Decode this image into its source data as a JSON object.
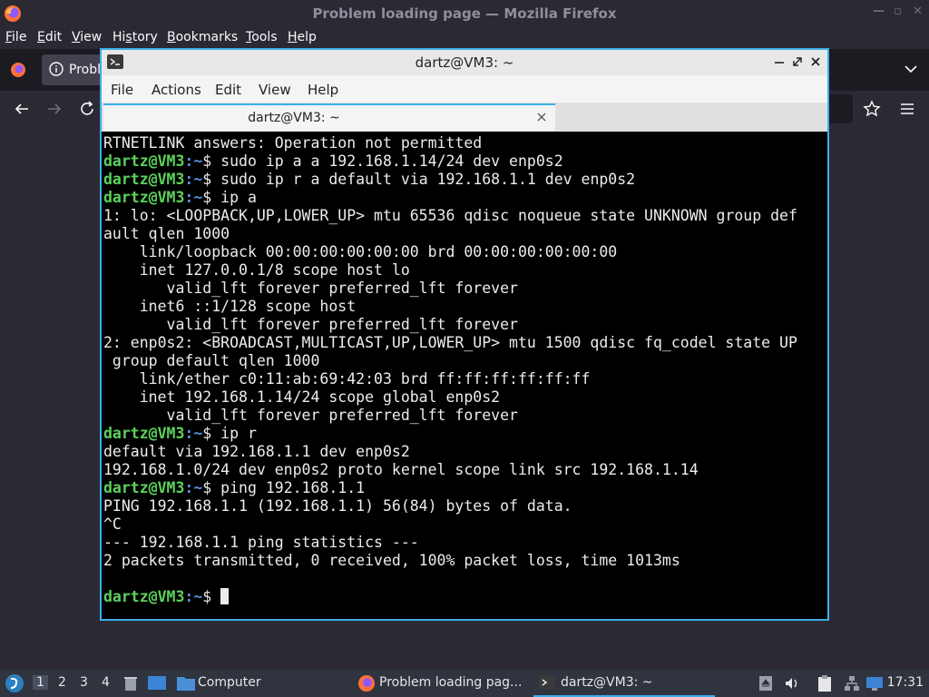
{
  "firefox": {
    "window_title": "Problem loading page — Mozilla Firefox",
    "menu": [
      "File",
      "Edit",
      "View",
      "History",
      "Bookmarks",
      "Tools",
      "Help"
    ],
    "menu_underline": [
      "F",
      "E",
      "V",
      "H",
      "B",
      "T",
      "H"
    ],
    "tab_title": "Probl"
  },
  "terminal": {
    "window_title": "dartz@VM3: ~",
    "menu": [
      "File",
      "Actions",
      "Edit",
      "View",
      "Help"
    ],
    "tab_title": "dartz@VM3: ~",
    "prompt_user": "dartz@VM3",
    "prompt_path": ":~",
    "prompt_symbol": "$ ",
    "lines": [
      {
        "text": "RTNETLINK answers: Operation not permitted"
      },
      {
        "prompt": true,
        "text": "sudo ip a a 192.168.1.14/24 dev enp0s2"
      },
      {
        "prompt": true,
        "text": "sudo ip r a default via 192.168.1.1 dev enp0s2"
      },
      {
        "prompt": true,
        "text": "ip a"
      },
      {
        "text": "1: lo: <LOOPBACK,UP,LOWER_UP> mtu 65536 qdisc noqueue state UNKNOWN group def"
      },
      {
        "text": "ault qlen 1000"
      },
      {
        "text": "    link/loopback 00:00:00:00:00:00 brd 00:00:00:00:00:00"
      },
      {
        "text": "    inet 127.0.0.1/8 scope host lo"
      },
      {
        "text": "       valid_lft forever preferred_lft forever"
      },
      {
        "text": "    inet6 ::1/128 scope host"
      },
      {
        "text": "       valid_lft forever preferred_lft forever"
      },
      {
        "text": "2: enp0s2: <BROADCAST,MULTICAST,UP,LOWER_UP> mtu 1500 qdisc fq_codel state UP"
      },
      {
        "text": " group default qlen 1000"
      },
      {
        "text": "    link/ether c0:11:ab:69:42:03 brd ff:ff:ff:ff:ff:ff"
      },
      {
        "text": "    inet 192.168.1.14/24 scope global enp0s2"
      },
      {
        "text": "       valid_lft forever preferred_lft forever"
      },
      {
        "prompt": true,
        "text": "ip r"
      },
      {
        "text": "default via 192.168.1.1 dev enp0s2"
      },
      {
        "text": "192.168.1.0/24 dev enp0s2 proto kernel scope link src 192.168.1.14"
      },
      {
        "prompt": true,
        "text": "ping 192.168.1.1"
      },
      {
        "text": "PING 192.168.1.1 (192.168.1.1) 56(84) bytes of data."
      },
      {
        "text": "^C"
      },
      {
        "text": "--- 192.168.1.1 ping statistics ---"
      },
      {
        "text": "2 packets transmitted, 0 received, 100% packet loss, time 1013ms"
      },
      {
        "text": ""
      },
      {
        "prompt": true,
        "text": "",
        "cursor": true
      }
    ]
  },
  "taskbar": {
    "workspaces": [
      "1",
      "2",
      "3",
      "4"
    ],
    "active_workspace": "1",
    "file_manager_label": "Computer",
    "tasks": [
      "Problem loading pag...",
      "dartz@VM3: ~"
    ],
    "clock": "17:31"
  },
  "colors": {
    "accent": "#3daee9",
    "prompt_user": "#5bd25b",
    "prompt_path": "#5b8fe0"
  }
}
